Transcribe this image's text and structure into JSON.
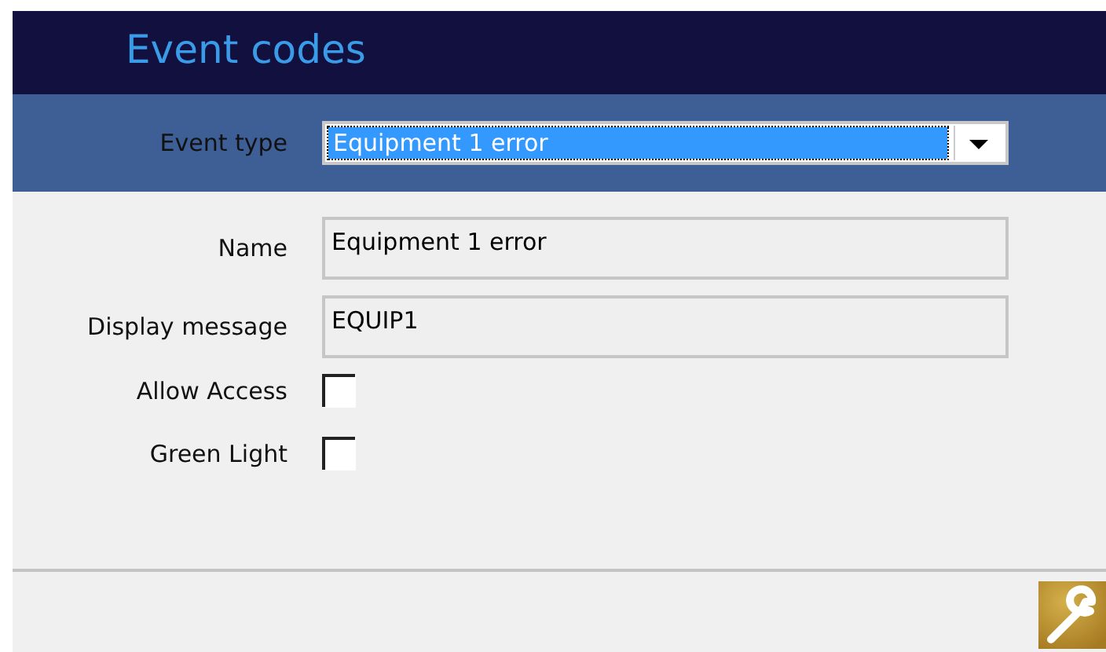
{
  "header": {
    "title": "Event codes"
  },
  "event_type": {
    "label": "Event type",
    "value": "Equipment 1 error",
    "focused": true
  },
  "fields": [
    {
      "label": "Name",
      "value": "Equipment 1 error"
    },
    {
      "label": "Display message",
      "value": "EQUIP1"
    }
  ],
  "checkboxes": [
    {
      "label": "Allow Access",
      "checked": false
    },
    {
      "label": "Green Light",
      "checked": false
    }
  ]
}
